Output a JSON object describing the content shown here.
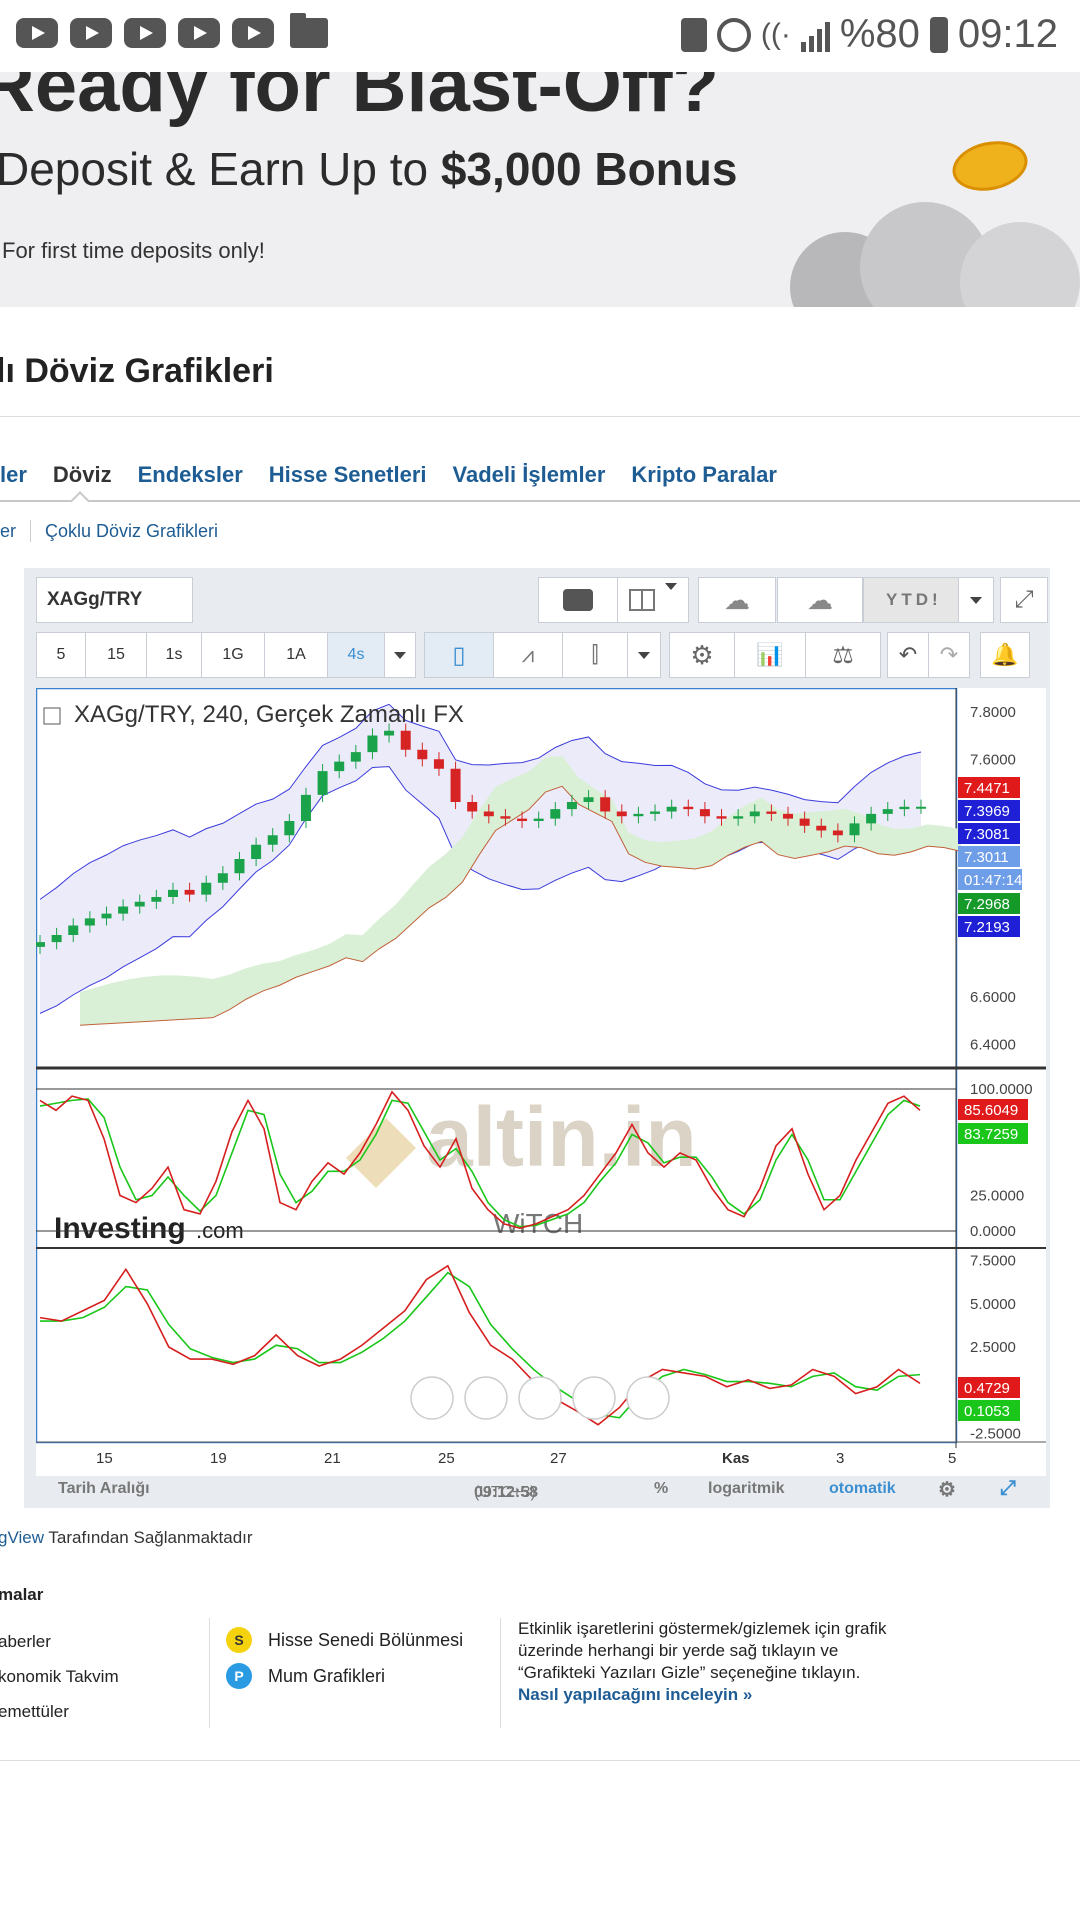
{
  "status_bar": {
    "battery": "%80",
    "time": "09:12",
    "app_icons": [
      "youtube-icon",
      "youtube-icon",
      "youtube-icon",
      "youtube-icon",
      "youtube-icon",
      "folder-icon"
    ]
  },
  "banner": {
    "headline": "Ready for Blast-Off?",
    "deposit_text": "Deposit & Earn Up to ",
    "bonus_text": "$3,000 Bonus",
    "note": "For first time deposits only!"
  },
  "page": {
    "title": "lı Döviz Grafikleri",
    "tabs": [
      {
        "label": "ler",
        "active": false
      },
      {
        "label": "Döviz",
        "active": true
      },
      {
        "label": "Endeksler",
        "active": false
      },
      {
        "label": "Hisse Senetleri",
        "active": false
      },
      {
        "label": "Vadeli İşlemler",
        "active": false
      },
      {
        "label": "Kripto Paralar",
        "active": false
      }
    ],
    "subnav": {
      "left": "er",
      "link": "Çoklu Döviz Grafikleri"
    }
  },
  "toolbar": {
    "symbol": "XAGg/TRY",
    "ytd_label": "YTD!",
    "resolutions": [
      "5",
      "15",
      "1s",
      "1G",
      "1A",
      "4s"
    ],
    "active_resolution": "4s"
  },
  "chart_data": {
    "type": "candlestick",
    "title": "XAGg/TRY, 240, Gerçek Zamanlı FX",
    "watermark": "altin.in",
    "watermark_sub": "WiTCH",
    "brand": "Investing",
    "brand_suffix": ".com",
    "x_ticks": [
      "15",
      "19",
      "21",
      "25",
      "27",
      "Kas",
      "3",
      "5"
    ],
    "main_pane": {
      "y_ticks": [
        "7.8000",
        "7.6000",
        "6.6000",
        "6.4000"
      ],
      "ylim": [
        6.3,
        7.9
      ],
      "price_labels": [
        {
          "value": "7.4471",
          "color": "#e01a1a"
        },
        {
          "value": "7.3969",
          "color": "#1f1fd6"
        },
        {
          "value": "7.3081",
          "color": "#1f1fd6"
        },
        {
          "value": "7.3011",
          "color": "#6f9ee8"
        },
        {
          "value": "01:47:14",
          "color": "#6f9ee8"
        },
        {
          "value": "7.2968",
          "color": "#159a2a"
        },
        {
          "value": "7.2193",
          "color": "#1f1fd6"
        }
      ],
      "close_values": [
        6.83,
        6.86,
        6.9,
        6.93,
        6.95,
        6.98,
        7.0,
        7.02,
        7.05,
        7.03,
        7.08,
        7.12,
        7.18,
        7.24,
        7.28,
        7.34,
        7.45,
        7.55,
        7.59,
        7.63,
        7.7,
        7.72,
        7.64,
        7.6,
        7.56,
        7.42,
        7.38,
        7.36,
        7.35,
        7.34,
        7.35,
        7.39,
        7.42,
        7.44,
        7.38,
        7.36,
        7.37,
        7.38,
        7.4,
        7.39,
        7.36,
        7.35,
        7.36,
        7.38,
        7.37,
        7.35,
        7.32,
        7.3,
        7.28,
        7.33,
        7.37,
        7.39,
        7.4,
        7.4
      ]
    },
    "stoch_pane": {
      "y_ticks": [
        "100.0000",
        "25.0000",
        "0.0000"
      ],
      "ylim": [
        0,
        100
      ],
      "labels": [
        {
          "value": "85.6049",
          "color": "#e01a1a"
        },
        {
          "value": "83.7259",
          "color": "#19c619"
        }
      ],
      "k_values": [
        92,
        85,
        95,
        92,
        65,
        25,
        20,
        30,
        45,
        15,
        12,
        35,
        70,
        92,
        72,
        20,
        15,
        35,
        48,
        40,
        55,
        75,
        98,
        85,
        60,
        45,
        65,
        30,
        15,
        5,
        2,
        5,
        10,
        15,
        25,
        40,
        55,
        75,
        55,
        45,
        55,
        50,
        30,
        15,
        10,
        30,
        60,
        72,
        40,
        15,
        25,
        50,
        70,
        90,
        95,
        85
      ],
      "d_values": [
        88,
        90,
        92,
        93,
        80,
        45,
        22,
        25,
        38,
        25,
        14,
        25,
        55,
        85,
        82,
        40,
        20,
        28,
        42,
        42,
        50,
        68,
        92,
        90,
        70,
        50,
        58,
        42,
        20,
        8,
        3,
        4,
        8,
        12,
        20,
        35,
        48,
        68,
        62,
        48,
        52,
        52,
        38,
        20,
        12,
        22,
        50,
        68,
        50,
        22,
        22,
        42,
        62,
        82,
        92,
        88
      ]
    },
    "macd_pane": {
      "y_ticks": [
        "7.5000",
        "5.0000",
        "2.5000",
        "-2.5000"
      ],
      "ylim": [
        -3,
        8
      ],
      "labels": [
        {
          "value": "0.4729",
          "color": "#e01a1a"
        },
        {
          "value": "0.1053",
          "color": "#19c619"
        }
      ],
      "red_values": [
        4.2,
        4.0,
        4.6,
        5.2,
        7.0,
        5.0,
        2.5,
        1.8,
        1.8,
        1.5,
        2.0,
        3.2,
        2.0,
        1.4,
        1.8,
        2.6,
        3.6,
        4.6,
        6.4,
        7.2,
        4.5,
        2.6,
        1.8,
        0.5,
        -0.5,
        -1.2,
        -2.0,
        -1.0,
        0.5,
        1.2,
        1.0,
        0.8,
        0.2,
        0.6,
        0.1,
        0.3,
        1.2,
        0.8,
        -0.2,
        0.2,
        1.2,
        0.4
      ],
      "green_values": [
        4.0,
        4.0,
        4.2,
        4.8,
        6.0,
        5.8,
        3.8,
        2.4,
        1.9,
        1.6,
        1.8,
        2.6,
        2.4,
        1.6,
        1.6,
        2.2,
        3.0,
        4.0,
        5.4,
        6.8,
        6.0,
        3.8,
        2.4,
        1.2,
        0.2,
        -0.6,
        -1.4,
        -1.6,
        -0.2,
        0.8,
        1.2,
        0.9,
        0.5,
        0.5,
        0.4,
        0.2,
        0.8,
        1.0,
        0.2,
        0.0,
        0.8,
        0.9
      ]
    }
  },
  "bottom_bar": {
    "date_range": "Tarih Aralığı",
    "clock": "09:12:58",
    "tz": "(UTC+3)",
    "percent": "%",
    "log": "logaritmik",
    "auto": "otomatik"
  },
  "footer": {
    "credit_tv": "gView",
    "credit_rest": " Tarafından Sağlanmaktadır",
    "legend_title": "malar",
    "col1": [
      "aberler",
      "konomik Takvim",
      "emettüler"
    ],
    "col2": [
      {
        "badge": "S",
        "badge_color": "#f5d20e",
        "label": "Hisse Senedi Bölünmesi"
      },
      {
        "badge": "P",
        "badge_color": "#2a9be3",
        "label": "Mum Grafikleri"
      }
    ],
    "note": "Etkinlik işaretlerini göstermek/gizlemek için grafik üzerinde herhangi bir yerde sağ tıklayın ve “Grafikteki Yazıları Gizle” seçeneğine tıklayın.",
    "note_link": "Nasıl yapılacağını inceleyin »"
  }
}
